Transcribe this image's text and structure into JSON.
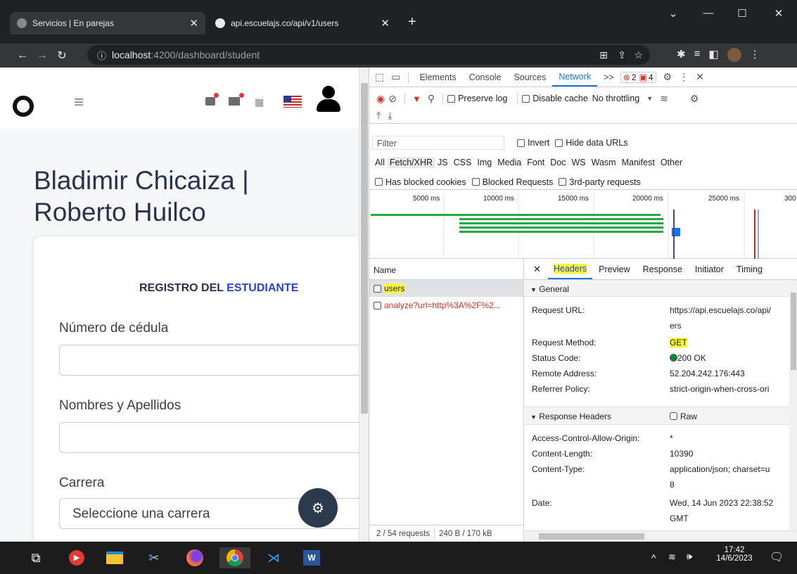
{
  "browser": {
    "tabs": [
      {
        "title": "Servicios | En parejas",
        "active": true
      },
      {
        "title": "api.escuelajs.co/api/v1/users",
        "active": false
      }
    ],
    "new_tab_label": "+",
    "url_host": "localhost",
    "url_rest": ":4200/dashboard/student"
  },
  "app": {
    "title_line1": "Bladimir Chicaiza |",
    "title_line2": "Roberto Huilco",
    "form_heading_a": "REGISTRO DEL ",
    "form_heading_b": "ESTUDIANTE",
    "cedula_label": "Número de cédula",
    "nombres_label": "Nombres y Apellidos",
    "carrera_label": "Carrera",
    "carrera_placeholder": "Seleccione una carrera",
    "accent_color": "#2c3fd1"
  },
  "devtools": {
    "tabs": [
      "Elements",
      "Console",
      "Sources",
      "Network"
    ],
    "selected_tab": "Network",
    "more": ">>",
    "errors_count": "2",
    "warnings_count": "4",
    "preserve_log": "Preserve log",
    "disable_cache": "Disable cache",
    "throttling": "No throttling",
    "filter_placeholder": "Filter",
    "invert": "Invert",
    "hide_data_urls": "Hide data URLs",
    "type_filters": [
      "All",
      "Fetch/XHR",
      "JS",
      "CSS",
      "Img",
      "Media",
      "Font",
      "Doc",
      "WS",
      "Wasm",
      "Manifest",
      "Other"
    ],
    "selected_type": "Fetch/XHR",
    "blocked_cookies": "Has blocked cookies",
    "blocked_requests": "Blocked Requests",
    "third_party": "3rd-party requests",
    "timeline_ticks": [
      "5000 ms",
      "10000 ms",
      "15000 ms",
      "20000 ms",
      "25000 ms",
      "300"
    ],
    "name_header": "Name",
    "requests": [
      {
        "name": "users",
        "error": false
      },
      {
        "name": "analyze?url=http%3A%2F%2...",
        "error": true
      }
    ],
    "status_requests": "2 / 54 requests",
    "status_size": "240 B / 170 kB",
    "detail_tabs": [
      "Headers",
      "Preview",
      "Response",
      "Initiator",
      "Timing"
    ],
    "general_title": "General",
    "general": [
      {
        "k": "Request URL:",
        "v": "https://api.escuelajs.co/api/",
        "v2": "ers"
      },
      {
        "k": "Request Method:",
        "v": "GET"
      },
      {
        "k": "Status Code:",
        "v": "200 OK"
      },
      {
        "k": "Remote Address:",
        "v": "52.204.242.176:443"
      },
      {
        "k": "Referrer Policy:",
        "v": "strict-origin-when-cross-ori"
      }
    ],
    "response_headers_title": "Response Headers",
    "raw_label": "Raw",
    "response_headers": [
      {
        "k": "Access-Control-Allow-Origin:",
        "v": "*"
      },
      {
        "k": "Content-Length:",
        "v": "10390"
      },
      {
        "k": "Content-Type:",
        "v": "application/json; charset=u",
        "v2": "8"
      },
      {
        "k": "Date:",
        "v": "Wed, 14 Jun 2023 22:38:52",
        "v2": "GMT"
      }
    ]
  },
  "taskbar": {
    "time": "17:42",
    "date": "14/6/2023"
  }
}
